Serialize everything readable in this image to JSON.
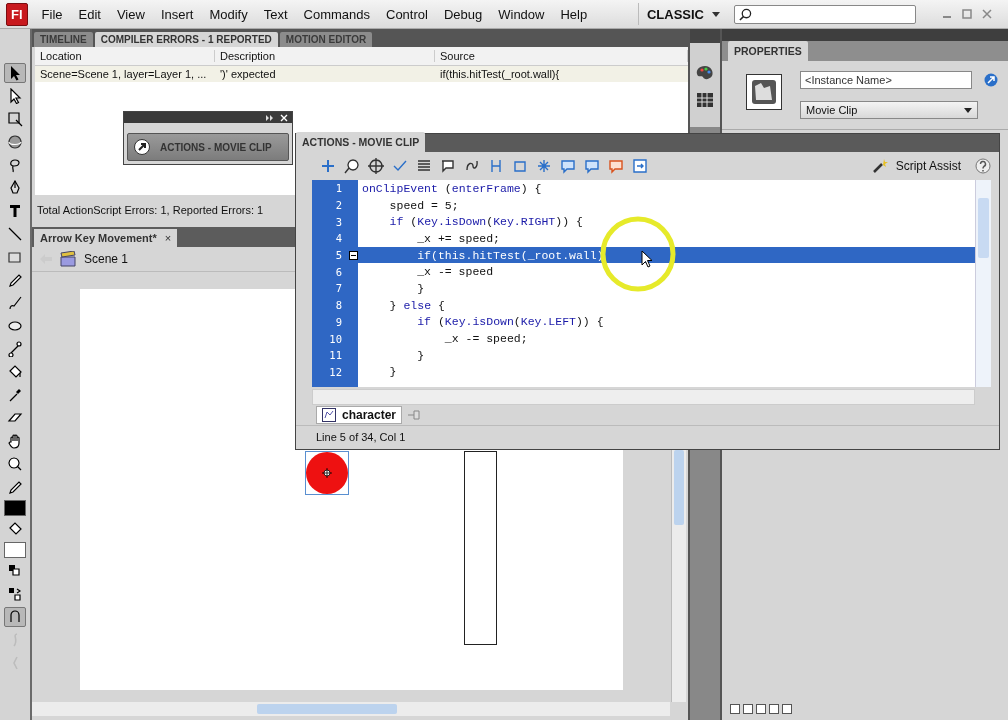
{
  "app": {
    "logo": "Fl",
    "menu": [
      "File",
      "Edit",
      "View",
      "Insert",
      "Modify",
      "Text",
      "Commands",
      "Control",
      "Debug",
      "Window",
      "Help"
    ],
    "workspace": "CLASSIC"
  },
  "tools": [
    {
      "kind": "select",
      "selected": true,
      "disabled": false
    },
    {
      "kind": "subselect",
      "selected": false,
      "disabled": false
    },
    {
      "kind": "free-transform",
      "selected": false,
      "disabled": false
    },
    {
      "kind": "rotation",
      "selected": false,
      "disabled": false
    },
    {
      "kind": "lasso",
      "selected": false,
      "disabled": false
    },
    {
      "kind": "pen",
      "selected": false,
      "disabled": false
    },
    {
      "kind": "text",
      "selected": false,
      "disabled": false
    },
    {
      "kind": "line",
      "selected": false,
      "disabled": false
    },
    {
      "kind": "rectangle",
      "selected": false,
      "disabled": false
    },
    {
      "kind": "pencil",
      "selected": false,
      "disabled": false
    },
    {
      "kind": "brush",
      "selected": false,
      "disabled": false
    },
    {
      "kind": "deco",
      "selected": false,
      "disabled": false
    },
    {
      "kind": "bone",
      "selected": false,
      "disabled": false
    },
    {
      "kind": "bucket",
      "selected": false,
      "disabled": false
    },
    {
      "kind": "eyedropper",
      "selected": false,
      "disabled": false
    },
    {
      "kind": "eraser",
      "selected": false,
      "disabled": false
    },
    {
      "kind": "hand",
      "selected": false,
      "disabled": false
    },
    {
      "kind": "zoom",
      "selected": false,
      "disabled": false
    },
    {
      "kind": "stroke",
      "selected": false,
      "disabled": false,
      "color": "#000000"
    },
    {
      "kind": "fill",
      "selected": false,
      "disabled": false,
      "color": "#ffffff"
    },
    {
      "kind": "default-colors",
      "selected": false,
      "disabled": false
    },
    {
      "kind": "swap-colors",
      "selected": false,
      "disabled": false
    },
    {
      "kind": "snap",
      "selected": true,
      "disabled": false
    },
    {
      "kind": "smooth",
      "selected": false,
      "disabled": true
    },
    {
      "kind": "straighten",
      "selected": false,
      "disabled": true
    }
  ],
  "output_panel": {
    "tabs": [
      {
        "label": "TIMELINE",
        "selected": false
      },
      {
        "label": "COMPILER ERRORS - 1 REPORTED",
        "selected": true
      },
      {
        "label": "MOTION EDITOR",
        "selected": false
      }
    ],
    "columns": [
      "Location",
      "Description",
      "Source"
    ],
    "rows": [
      [
        "Scene=Scene 1, layer=Layer 1, ...",
        "')' expected",
        "if(this.hitTest(_root.wall){"
      ]
    ],
    "summary": "Total ActionScript Errors: 1,  Reported Errors: 1"
  },
  "document": {
    "tab": "Arrow Key Movement*",
    "close": "×",
    "scene": "Scene 1"
  },
  "properties": {
    "title": "PROPERTIES",
    "instance_name_placeholder": "<Instance Name>",
    "symbol_type": "Movie Clip"
  },
  "collapsed_panel": {
    "label": "ACTIONS - MOVIE CLIP"
  },
  "actions_panel": {
    "title": "ACTIONS - MOVIE CLIP",
    "script_assist": "Script Assist",
    "script_tab": "character",
    "status": "Line 5 of 34, Col 1",
    "lines": [
      {
        "number": "1",
        "selected": false,
        "fold": false,
        "tokens": [
          {
            "text": "onClipEvent",
            "kind": "keyword"
          },
          {
            "text": " (",
            "kind": "plain"
          },
          {
            "text": "enterFrame",
            "kind": "keyword"
          },
          {
            "text": ") {",
            "kind": "plain"
          }
        ]
      },
      {
        "number": "2",
        "selected": false,
        "fold": false,
        "tokens": [
          {
            "text": "    speed = 5;",
            "kind": "plain"
          }
        ]
      },
      {
        "number": "3",
        "selected": false,
        "fold": false,
        "tokens": [
          {
            "text": "    if",
            "kind": "keyword"
          },
          {
            "text": " (",
            "kind": "plain"
          },
          {
            "text": "Key.isDown",
            "kind": "keyword"
          },
          {
            "text": "(",
            "kind": "plain"
          },
          {
            "text": "Key.RIGHT",
            "kind": "keyword"
          },
          {
            "text": ")) {",
            "kind": "plain"
          }
        ]
      },
      {
        "number": "4",
        "selected": false,
        "fold": false,
        "tokens": [
          {
            "text": "        _x += speed;",
            "kind": "plain"
          }
        ]
      },
      {
        "number": "5",
        "selected": true,
        "fold": true,
        "tokens": [
          {
            "text": "        if(this.hitTest(_root.wall)",
            "kind": "plain"
          }
        ]
      },
      {
        "number": "6",
        "selected": false,
        "fold": false,
        "tokens": [
          {
            "text": "        _x -= speed",
            "kind": "plain"
          }
        ]
      },
      {
        "number": "7",
        "selected": false,
        "fold": false,
        "tokens": [
          {
            "text": "        }",
            "kind": "plain"
          }
        ]
      },
      {
        "number": "8",
        "selected": false,
        "fold": false,
        "tokens": [
          {
            "text": "    } ",
            "kind": "plain"
          },
          {
            "text": "else",
            "kind": "keyword"
          },
          {
            "text": " {",
            "kind": "plain"
          }
        ]
      },
      {
        "number": "9",
        "selected": false,
        "fold": false,
        "tokens": [
          {
            "text": "        if",
            "kind": "keyword"
          },
          {
            "text": " (",
            "kind": "plain"
          },
          {
            "text": "Key.isDown",
            "kind": "keyword"
          },
          {
            "text": "(",
            "kind": "plain"
          },
          {
            "text": "Key.LEFT",
            "kind": "keyword"
          },
          {
            "text": ")) {",
            "kind": "plain"
          }
        ]
      },
      {
        "number": "10",
        "selected": false,
        "fold": false,
        "tokens": [
          {
            "text": "            _x -= speed;",
            "kind": "plain"
          }
        ]
      },
      {
        "number": "11",
        "selected": false,
        "fold": false,
        "tokens": [
          {
            "text": "        }",
            "kind": "plain"
          }
        ]
      },
      {
        "number": "12",
        "selected": false,
        "fold": false,
        "tokens": [
          {
            "text": "    }",
            "kind": "plain"
          }
        ]
      }
    ]
  }
}
